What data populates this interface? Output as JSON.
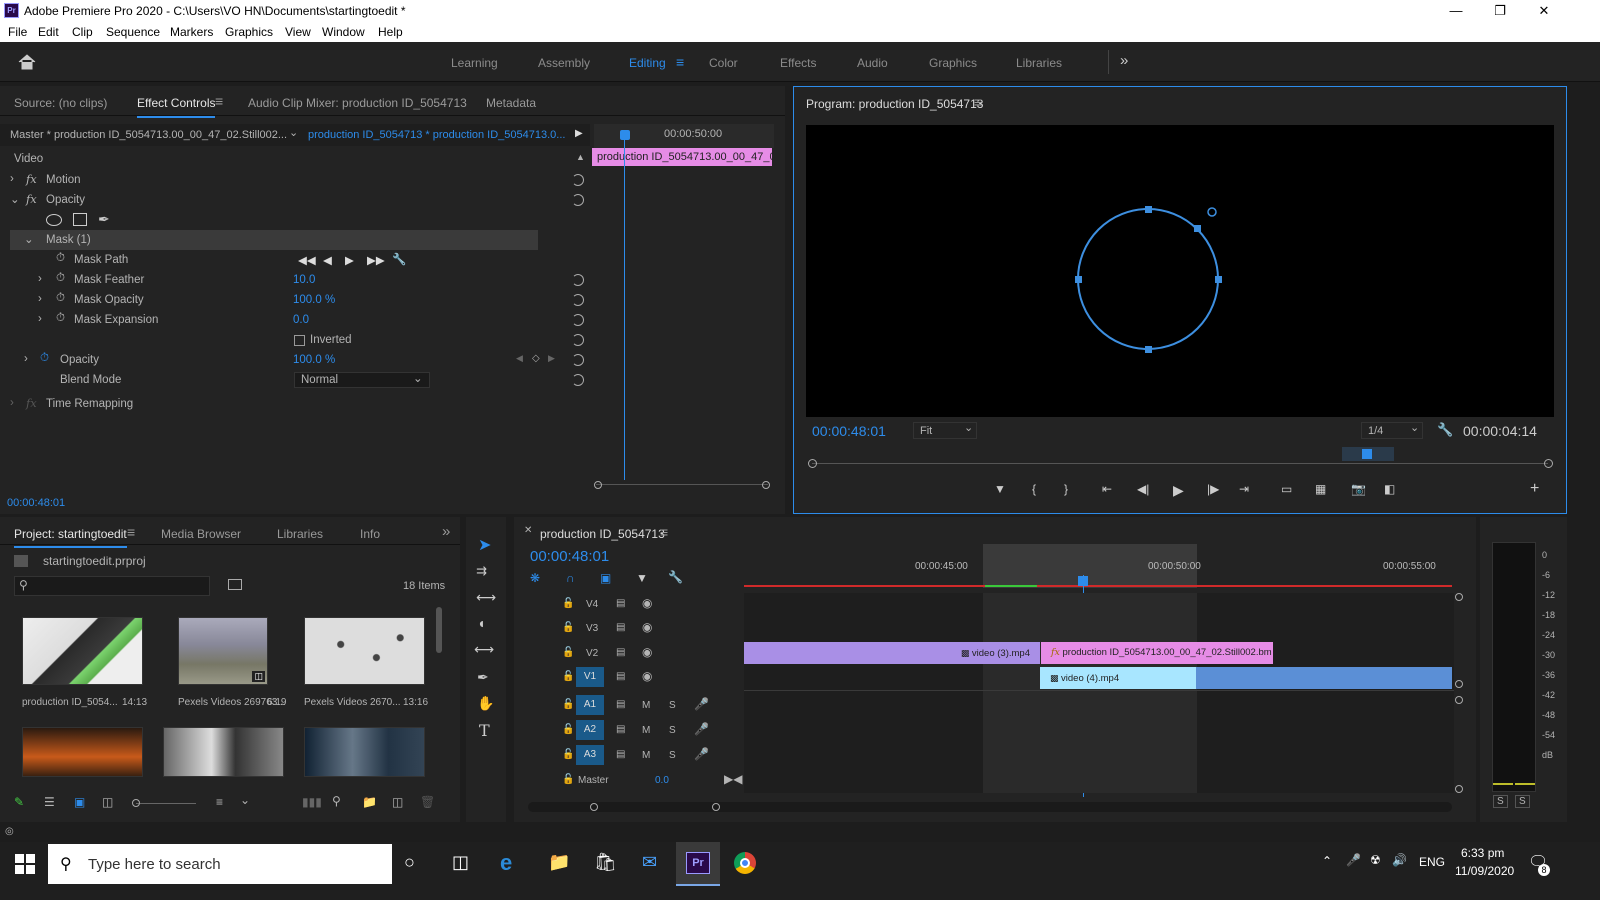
{
  "window": {
    "app_title": "Adobe Premiere Pro 2020 - C:\\Users\\VO HN\\Documents\\startingtoedit *",
    "logo": "Pr"
  },
  "menu": [
    "File",
    "Edit",
    "Clip",
    "Sequence",
    "Markers",
    "Graphics",
    "View",
    "Window",
    "Help"
  ],
  "workspaces": [
    "Learning",
    "Assembly",
    "Editing",
    "Color",
    "Effects",
    "Audio",
    "Graphics",
    "Libraries"
  ],
  "active_workspace": "Editing",
  "source_panel": {
    "tabs": [
      "Source: (no clips)",
      "Effect Controls",
      "Audio Clip Mixer: production ID_5054713",
      "Metadata"
    ],
    "master_label": "Master * production ID_5054713.00_00_47_02.Still002...",
    "seq_label": "production ID_5054713 * production ID_5054713.0...",
    "mini_time": "00:00:50:00",
    "mini_clip": "production ID_5054713.00_00_47_0",
    "section_video": "Video",
    "rows": {
      "motion": "Motion",
      "opacity_fx": "Opacity",
      "mask": "Mask (1)",
      "mask_path": "Mask Path",
      "mask_feather": "Mask Feather",
      "mask_opacity": "Mask Opacity",
      "mask_expansion": "Mask Expansion",
      "inverted": "Inverted",
      "opacity": "Opacity",
      "blend_mode": "Blend Mode",
      "time_remap": "Time Remapping"
    },
    "values": {
      "mask_feather": "10.0",
      "mask_opacity": "100.0 %",
      "mask_expansion": "0.0",
      "opacity": "100.0 %",
      "blend_mode": "Normal"
    },
    "fx": "fx",
    "timecode": "00:00:48:01"
  },
  "program": {
    "title": "Program: production ID_5054713",
    "timecode": "00:00:48:01",
    "fit": "Fit",
    "resolution": "1/4",
    "duration": "00:00:04:14"
  },
  "project": {
    "tabs": [
      "Project: startingtoedit",
      "Media Browser",
      "Libraries",
      "Info"
    ],
    "file": "startingtoedit.prproj",
    "items_count": "18 Items",
    "items": [
      {
        "name": "production ID_5054...",
        "dur": "14:13"
      },
      {
        "name": "Pexels Videos 269763...",
        "dur": "6:19"
      },
      {
        "name": "Pexels Videos 2670...",
        "dur": "13:16"
      }
    ]
  },
  "timeline": {
    "seq": "production ID_5054713",
    "timecode": "00:00:48:01",
    "ruler": [
      "00:00:45:00",
      "00:00:50:00",
      "00:00:55:00"
    ],
    "tracks_v": [
      "V4",
      "V3",
      "V2",
      "V1"
    ],
    "tracks_a": [
      "A1",
      "A2",
      "A3"
    ],
    "m": "M",
    "s": "S",
    "master": "Master",
    "master_val": "0.0",
    "clips": {
      "v2a": "video (3).mp4",
      "v2b": "production ID_5054713.00_00_47_02.Still002.bm",
      "v1": "video (4).mp4"
    },
    "fx": "fx"
  },
  "meter": {
    "scale": [
      "0",
      "-6",
      "-12",
      "-18",
      "-24",
      "-30",
      "-36",
      "-42",
      "-48",
      "-54",
      "dB"
    ],
    "solo": "S"
  },
  "taskbar": {
    "search": "Type here to search",
    "lang": "ENG",
    "time": "6:33 pm",
    "date": "11/09/2020",
    "notif": "8"
  }
}
